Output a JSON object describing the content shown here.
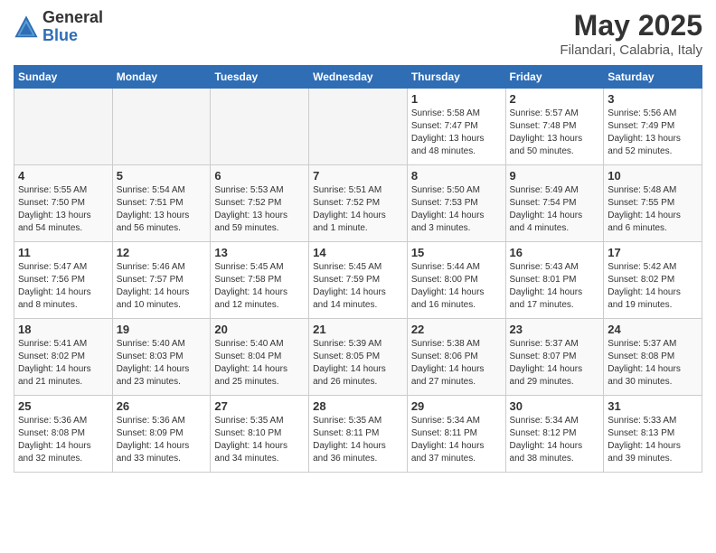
{
  "header": {
    "logo_line1": "General",
    "logo_line2": "Blue",
    "month_title": "May 2025",
    "location": "Filandari, Calabria, Italy"
  },
  "weekdays": [
    "Sunday",
    "Monday",
    "Tuesday",
    "Wednesday",
    "Thursday",
    "Friday",
    "Saturday"
  ],
  "weeks": [
    [
      {
        "day": "",
        "info": ""
      },
      {
        "day": "",
        "info": ""
      },
      {
        "day": "",
        "info": ""
      },
      {
        "day": "",
        "info": ""
      },
      {
        "day": "1",
        "info": "Sunrise: 5:58 AM\nSunset: 7:47 PM\nDaylight: 13 hours\nand 48 minutes."
      },
      {
        "day": "2",
        "info": "Sunrise: 5:57 AM\nSunset: 7:48 PM\nDaylight: 13 hours\nand 50 minutes."
      },
      {
        "day": "3",
        "info": "Sunrise: 5:56 AM\nSunset: 7:49 PM\nDaylight: 13 hours\nand 52 minutes."
      }
    ],
    [
      {
        "day": "4",
        "info": "Sunrise: 5:55 AM\nSunset: 7:50 PM\nDaylight: 13 hours\nand 54 minutes."
      },
      {
        "day": "5",
        "info": "Sunrise: 5:54 AM\nSunset: 7:51 PM\nDaylight: 13 hours\nand 56 minutes."
      },
      {
        "day": "6",
        "info": "Sunrise: 5:53 AM\nSunset: 7:52 PM\nDaylight: 13 hours\nand 59 minutes."
      },
      {
        "day": "7",
        "info": "Sunrise: 5:51 AM\nSunset: 7:52 PM\nDaylight: 14 hours\nand 1 minute."
      },
      {
        "day": "8",
        "info": "Sunrise: 5:50 AM\nSunset: 7:53 PM\nDaylight: 14 hours\nand 3 minutes."
      },
      {
        "day": "9",
        "info": "Sunrise: 5:49 AM\nSunset: 7:54 PM\nDaylight: 14 hours\nand 4 minutes."
      },
      {
        "day": "10",
        "info": "Sunrise: 5:48 AM\nSunset: 7:55 PM\nDaylight: 14 hours\nand 6 minutes."
      }
    ],
    [
      {
        "day": "11",
        "info": "Sunrise: 5:47 AM\nSunset: 7:56 PM\nDaylight: 14 hours\nand 8 minutes."
      },
      {
        "day": "12",
        "info": "Sunrise: 5:46 AM\nSunset: 7:57 PM\nDaylight: 14 hours\nand 10 minutes."
      },
      {
        "day": "13",
        "info": "Sunrise: 5:45 AM\nSunset: 7:58 PM\nDaylight: 14 hours\nand 12 minutes."
      },
      {
        "day": "14",
        "info": "Sunrise: 5:45 AM\nSunset: 7:59 PM\nDaylight: 14 hours\nand 14 minutes."
      },
      {
        "day": "15",
        "info": "Sunrise: 5:44 AM\nSunset: 8:00 PM\nDaylight: 14 hours\nand 16 minutes."
      },
      {
        "day": "16",
        "info": "Sunrise: 5:43 AM\nSunset: 8:01 PM\nDaylight: 14 hours\nand 17 minutes."
      },
      {
        "day": "17",
        "info": "Sunrise: 5:42 AM\nSunset: 8:02 PM\nDaylight: 14 hours\nand 19 minutes."
      }
    ],
    [
      {
        "day": "18",
        "info": "Sunrise: 5:41 AM\nSunset: 8:02 PM\nDaylight: 14 hours\nand 21 minutes."
      },
      {
        "day": "19",
        "info": "Sunrise: 5:40 AM\nSunset: 8:03 PM\nDaylight: 14 hours\nand 23 minutes."
      },
      {
        "day": "20",
        "info": "Sunrise: 5:40 AM\nSunset: 8:04 PM\nDaylight: 14 hours\nand 25 minutes."
      },
      {
        "day": "21",
        "info": "Sunrise: 5:39 AM\nSunset: 8:05 PM\nDaylight: 14 hours\nand 26 minutes."
      },
      {
        "day": "22",
        "info": "Sunrise: 5:38 AM\nSunset: 8:06 PM\nDaylight: 14 hours\nand 27 minutes."
      },
      {
        "day": "23",
        "info": "Sunrise: 5:37 AM\nSunset: 8:07 PM\nDaylight: 14 hours\nand 29 minutes."
      },
      {
        "day": "24",
        "info": "Sunrise: 5:37 AM\nSunset: 8:08 PM\nDaylight: 14 hours\nand 30 minutes."
      }
    ],
    [
      {
        "day": "25",
        "info": "Sunrise: 5:36 AM\nSunset: 8:08 PM\nDaylight: 14 hours\nand 32 minutes."
      },
      {
        "day": "26",
        "info": "Sunrise: 5:36 AM\nSunset: 8:09 PM\nDaylight: 14 hours\nand 33 minutes."
      },
      {
        "day": "27",
        "info": "Sunrise: 5:35 AM\nSunset: 8:10 PM\nDaylight: 14 hours\nand 34 minutes."
      },
      {
        "day": "28",
        "info": "Sunrise: 5:35 AM\nSunset: 8:11 PM\nDaylight: 14 hours\nand 36 minutes."
      },
      {
        "day": "29",
        "info": "Sunrise: 5:34 AM\nSunset: 8:11 PM\nDaylight: 14 hours\nand 37 minutes."
      },
      {
        "day": "30",
        "info": "Sunrise: 5:34 AM\nSunset: 8:12 PM\nDaylight: 14 hours\nand 38 minutes."
      },
      {
        "day": "31",
        "info": "Sunrise: 5:33 AM\nSunset: 8:13 PM\nDaylight: 14 hours\nand 39 minutes."
      }
    ]
  ]
}
